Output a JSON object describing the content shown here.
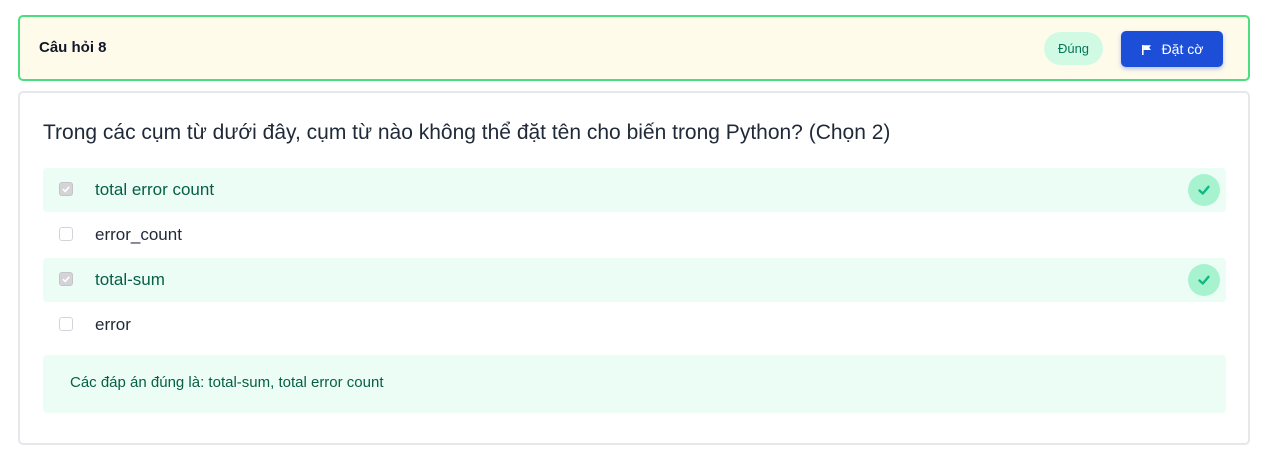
{
  "header": {
    "title": "Câu hỏi 8",
    "status_badge": "Đúng",
    "flag_label": "Đặt cờ",
    "flag_icon": "flag-icon"
  },
  "question": {
    "text": "Trong các cụm từ dưới đây, cụm từ nào không thể đặt tên cho biến trong Python? (Chọn 2)",
    "options": [
      {
        "label": "total error count",
        "checked": true,
        "correct": true
      },
      {
        "label": "error_count",
        "checked": false,
        "correct": false
      },
      {
        "label": "total-sum",
        "checked": true,
        "correct": true
      },
      {
        "label": "error",
        "checked": false,
        "correct": false
      }
    ],
    "answer_feedback": "Các đáp án đúng là: total-sum, total error count"
  },
  "colors": {
    "accent_blue": "#1d4ed8",
    "success_green": "#10b981",
    "header_bg": "#fffbeb",
    "header_border": "#4ade80",
    "correct_bg": "#ecfdf5"
  }
}
